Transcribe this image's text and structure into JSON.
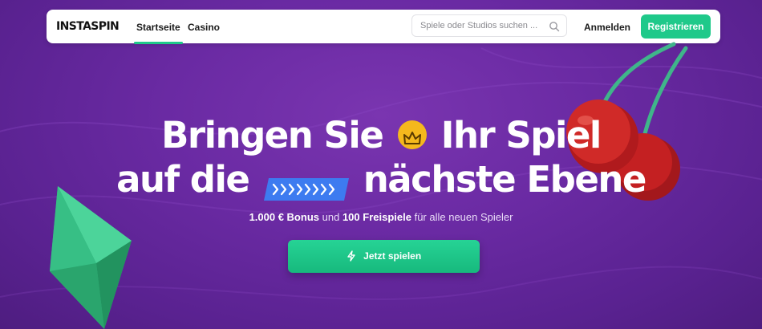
{
  "nav": {
    "logo": "INSTASPIN",
    "links": [
      {
        "label": "Startseite",
        "active": true
      },
      {
        "label": "Casino",
        "active": false
      }
    ],
    "search_placeholder": "Spiele oder Studios suchen ...",
    "login_label": "Anmelden",
    "register_label": "Registrieren"
  },
  "hero": {
    "headline_line1_part1": "Bringen Sie",
    "headline_line1_part2": "Ihr Spiel",
    "headline_line2_part1": "auf die",
    "headline_line2_part2": "nächste Ebene",
    "sub_bonus": "1.000 € Bonus",
    "sub_and": "und",
    "sub_spins": "100 Freispiele",
    "sub_rest": "für alle neuen Spieler",
    "cta_label": "Jetzt spielen"
  },
  "icons": {
    "search": "search-icon",
    "crown": "crown-icon",
    "arrows": "double-chevron-icon",
    "lightning": "lightning-icon",
    "cherries": "cherries-illustration",
    "gem": "gem-illustration"
  },
  "colors": {
    "accent": "#1fc98a",
    "background": "#6a2aa3",
    "crown_badge": "#f5b81d",
    "arrows_badge": "#3d7bf0",
    "cherry": "#c41f1f"
  }
}
